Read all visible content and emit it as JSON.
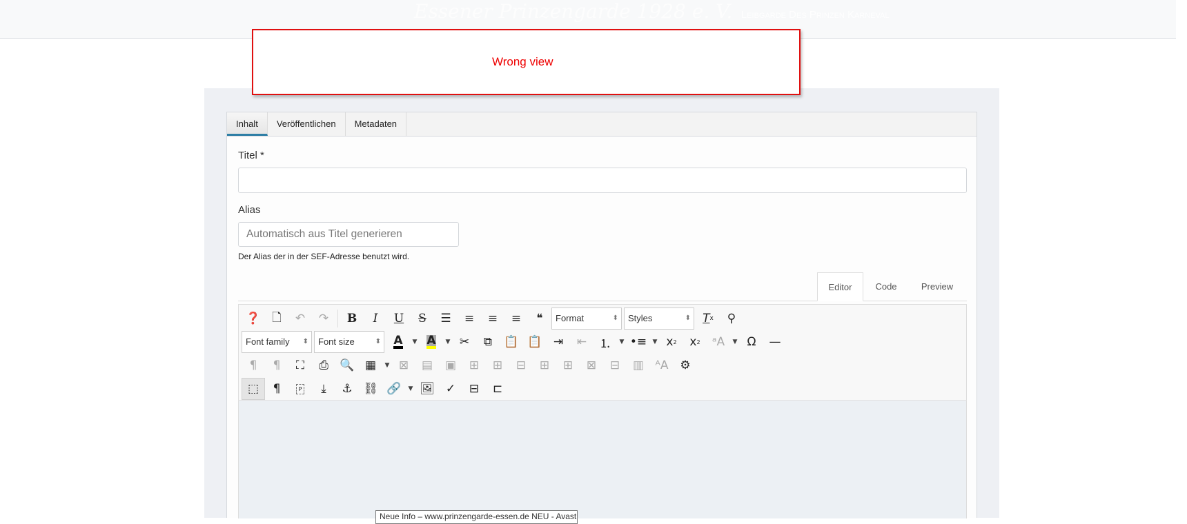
{
  "header": {
    "brand": "Essener Prinzengarde 1928 e. V.",
    "tagline": "Leibgarde Des Prinzen Karneval"
  },
  "annotation": {
    "text": "Wrong view",
    "color": "#e00000"
  },
  "tabs": [
    {
      "label": "Inhalt",
      "active": true
    },
    {
      "label": "Veröffentlichen"
    },
    {
      "label": "Metadaten"
    }
  ],
  "form": {
    "title_label": "Titel *",
    "title_value": "",
    "alias_label": "Alias",
    "alias_placeholder": "Automatisch aus Titel generieren",
    "alias_help": "Der Alias der in der SEF-Adresse benutzt wird."
  },
  "editor_tabs": [
    {
      "label": "Editor",
      "active": true
    },
    {
      "label": "Code"
    },
    {
      "label": "Preview"
    }
  ],
  "toolbar": {
    "rows": [
      [
        {
          "icon": "help"
        },
        {
          "icon": "new-document"
        },
        {
          "icon": "undo",
          "disabled": true
        },
        {
          "icon": "redo",
          "disabled": true
        },
        {
          "sep": true
        },
        {
          "icon": "bold"
        },
        {
          "icon": "italic"
        },
        {
          "icon": "underline"
        },
        {
          "icon": "strikethrough"
        },
        {
          "icon": "align-justify"
        },
        {
          "icon": "align-center"
        },
        {
          "icon": "align-left"
        },
        {
          "icon": "align-right"
        },
        {
          "icon": "blockquote"
        },
        {
          "select": "Format",
          "w": 102
        },
        {
          "select": "Styles",
          "w": 102
        },
        {
          "icon": "clear-formatting"
        },
        {
          "icon": "clean-up"
        }
      ],
      [
        {
          "select": "Font family",
          "w": 102
        },
        {
          "select": "Font size",
          "w": 102
        },
        {
          "icon": "text-color"
        },
        {
          "icon": "arrow"
        },
        {
          "icon": "background-color"
        },
        {
          "icon": "arrow"
        },
        {
          "icon": "cut"
        },
        {
          "icon": "copy"
        },
        {
          "icon": "paste"
        },
        {
          "icon": "paste-text"
        },
        {
          "icon": "indent"
        },
        {
          "icon": "outdent",
          "disabled": true
        },
        {
          "icon": "numbered-list"
        },
        {
          "icon": "arrow"
        },
        {
          "icon": "bullet-list"
        },
        {
          "icon": "arrow"
        },
        {
          "icon": "subscript"
        },
        {
          "icon": "superscript"
        },
        {
          "icon": "font-size-change",
          "disabled": true
        },
        {
          "icon": "arrow"
        },
        {
          "icon": "special-character"
        },
        {
          "icon": "horizontal-rule"
        }
      ],
      [
        {
          "icon": "ltr",
          "disabled": true
        },
        {
          "icon": "rtl",
          "disabled": true
        },
        {
          "icon": "fullscreen"
        },
        {
          "icon": "print"
        },
        {
          "icon": "search-replace"
        },
        {
          "icon": "table"
        },
        {
          "icon": "arrow"
        },
        {
          "icon": "delete-table",
          "disabled": true
        },
        {
          "icon": "row-props",
          "disabled": true
        },
        {
          "icon": "cell-props",
          "disabled": true
        },
        {
          "icon": "insert-row-before",
          "disabled": true
        },
        {
          "icon": "insert-row-after",
          "disabled": true
        },
        {
          "icon": "delete-row",
          "disabled": true
        },
        {
          "icon": "insert-col-before",
          "disabled": true
        },
        {
          "icon": "insert-col-after",
          "disabled": true
        },
        {
          "icon": "delete-col",
          "disabled": true
        },
        {
          "icon": "split-cells",
          "disabled": true
        },
        {
          "icon": "merge-cells",
          "disabled": true
        },
        {
          "icon": "style-formats",
          "disabled": true
        },
        {
          "icon": "settings"
        }
      ],
      [
        {
          "icon": "visual-aid",
          "active": true
        },
        {
          "icon": "show-blocks-pilcrow"
        },
        {
          "icon": "show-blocks"
        },
        {
          "icon": "insert-template"
        },
        {
          "icon": "anchor"
        },
        {
          "icon": "unlink"
        },
        {
          "icon": "link"
        },
        {
          "icon": "arrow"
        },
        {
          "icon": "image"
        },
        {
          "icon": "spellcheck"
        },
        {
          "icon": "page-break"
        },
        {
          "icon": "code-sample"
        }
      ]
    ]
  },
  "tooltip": "Neue Info – www.prinzengarde-essen.de NEU - Avast"
}
